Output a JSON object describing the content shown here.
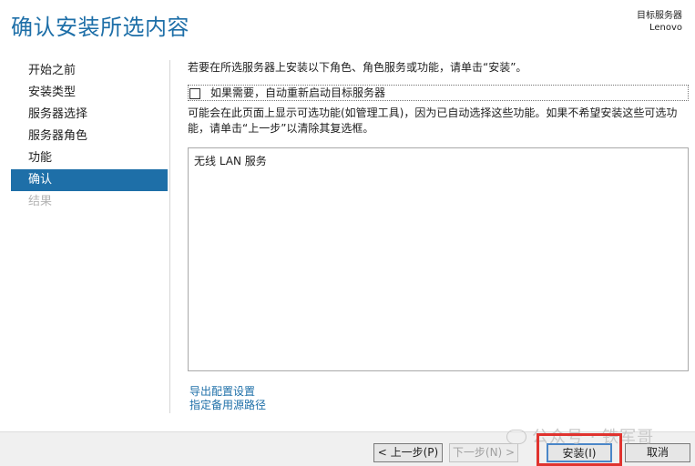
{
  "page": {
    "title": "确认安装所选内容",
    "target_label": "目标服务器",
    "target_value": "Lenovo"
  },
  "nav": {
    "items": [
      {
        "label": "开始之前",
        "state": "normal"
      },
      {
        "label": "安装类型",
        "state": "normal"
      },
      {
        "label": "服务器选择",
        "state": "normal"
      },
      {
        "label": "服务器角色",
        "state": "normal"
      },
      {
        "label": "功能",
        "state": "normal"
      },
      {
        "label": "确认",
        "state": "active"
      },
      {
        "label": "结果",
        "state": "disabled"
      }
    ]
  },
  "main": {
    "intro": "若要在所选服务器上安装以下角色、角色服务或功能，请单击“安装”。",
    "restart_label": "如果需要，自动重新启动目标服务器",
    "restart_checked": false,
    "note": "可能会在此页面上显示可选功能(如管理工具)，因为已自动选择这些功能。如果不希望安装这些可选功能，请单击“上一步”以清除其复选框。",
    "selected_items": [
      "无线 LAN 服务"
    ],
    "links": {
      "export": "导出配置设置",
      "alternate_source": "指定备用源路径"
    }
  },
  "footer": {
    "prev_label": "< 上一步(P)",
    "next_label": "下一步(N) >",
    "install_label": "安装(I)",
    "cancel_label": "取消"
  },
  "watermark": {
    "text": "公众号 · 铁军哥"
  },
  "colors": {
    "accent": "#1e6fa8",
    "highlight": "#e0332f"
  }
}
